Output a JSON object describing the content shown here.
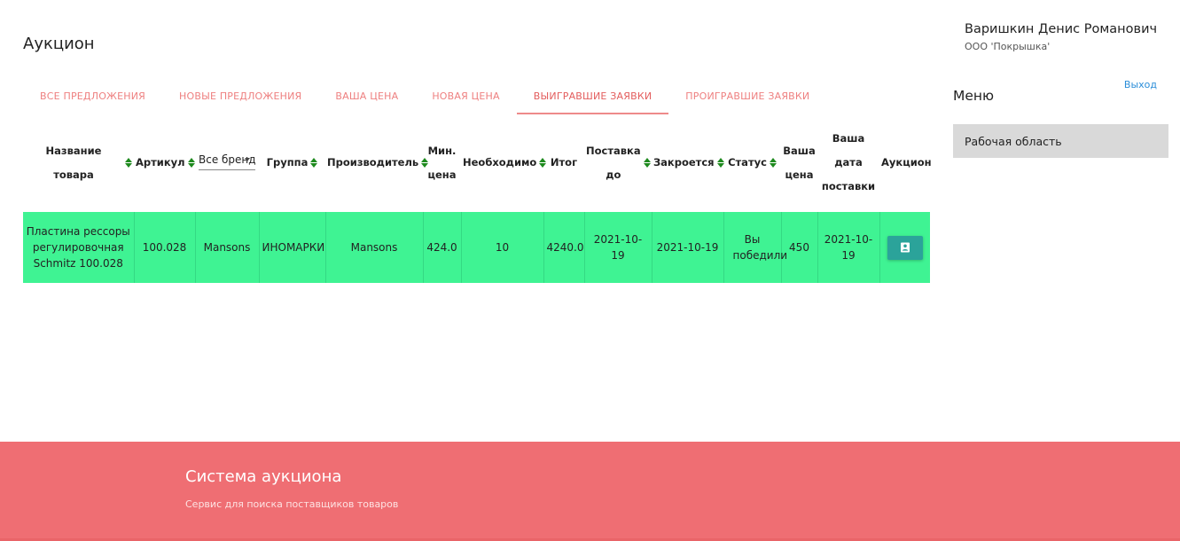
{
  "page": {
    "title": "Аукцион"
  },
  "tabs": [
    {
      "label": "ВСЕ ПРЕДЛОЖЕНИЯ"
    },
    {
      "label": "НОВЫЕ ПРЕДЛОЖЕНИЯ"
    },
    {
      "label": "ВАША ЦЕНА"
    },
    {
      "label": "НОВАЯ ЦЕНА"
    },
    {
      "label": "ВЫИГРАВШИЕ ЗАЯВКИ"
    },
    {
      "label": "ПРОИГРАВШИЕ ЗАЯВКИ"
    }
  ],
  "active_tab": "ВЫИГРАВШИЕ ЗАЯВКИ",
  "user": {
    "name": "Варишкин Денис Романович",
    "org": "ООО 'Покрышка'",
    "logout_label": "Выход"
  },
  "menu": {
    "title": "Меню",
    "items": [
      {
        "label": "Рабочая область"
      }
    ]
  },
  "table": {
    "headers": {
      "name": "Название товара",
      "article": "Артикул",
      "brand_filter": "Все бренды",
      "group": "Группа",
      "manufacturer": "Производитель",
      "min_price_1": "Мин.",
      "min_price_2": "цена",
      "required": "Необходимо",
      "total": "Итог",
      "delivery_1": "Поставка",
      "delivery_2": "до",
      "closes": "Закроется",
      "status": "Статус",
      "your_price_1": "Ваша",
      "your_price_2": "цена",
      "your_date_1": "Ваша дата",
      "your_date_2": "поставки",
      "auction": "Аукцион"
    },
    "rows": [
      {
        "name": "Пластина рессоры регулировочная Schmitz 100.028",
        "article": "100.028",
        "brand": "Mansons",
        "group": "ИНОМАРКИ",
        "manufacturer": "Mansons",
        "min_price": "424.0",
        "required": "10",
        "total": "4240.0",
        "delivery_until": "2021-10-19",
        "closes": "2021-10-19",
        "status": "Вы победили",
        "your_price": "450",
        "your_delivery_date": "2021-10-19"
      }
    ]
  },
  "colors": {
    "accent": "#ef6e73",
    "tab_text": "#ee8080",
    "row_win": "#3ff393",
    "sort_arrow": "#1e8a1e",
    "auction_button": "#2ba39a",
    "menu_item_bg": "#d9d9d9",
    "link": "#2b8ed9"
  },
  "icons": {
    "sort": "sort-arrows-icon",
    "auction": "contact-card-icon"
  },
  "footer": {
    "title": "Система аукциона",
    "subtitle": "Сервис для поиска поставщиков товаров"
  }
}
